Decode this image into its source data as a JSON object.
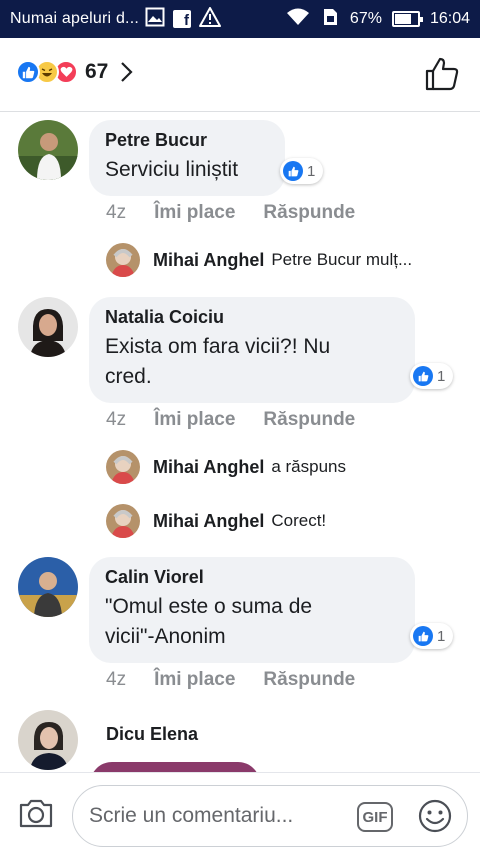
{
  "status_bar": {
    "carrier": "Numai apeluri d...",
    "battery": "67%",
    "time": "16:04",
    "icons": [
      "image-icon",
      "facebook-icon",
      "warning-icon",
      "wifi-icon",
      "sim-icon",
      "battery-icon"
    ]
  },
  "header": {
    "reaction_count": "67",
    "reaction_icons": [
      "like-icon",
      "haha-icon",
      "love-icon"
    ]
  },
  "comments": [
    {
      "author": "Petre Bucur",
      "text": "Serviciu liniștit",
      "reactions": "1",
      "time": "4z",
      "like": "Îmi place",
      "reply": "Răspunde",
      "replies": [
        {
          "name": "Mihai Anghel",
          "text": "Petre Bucur mulț..."
        }
      ]
    },
    {
      "author": "Natalia Coiciu",
      "text_line1": "Exista om fara vicii?! Nu",
      "text_line2": "cred.",
      "reactions": "1",
      "time": "4z",
      "like": "Îmi place",
      "reply": "Răspunde",
      "replies": [
        {
          "name": "Mihai Anghel",
          "text": "a răspuns"
        },
        {
          "name": "Mihai Anghel",
          "text": "Corect!"
        }
      ]
    },
    {
      "author": "Calin Viorel",
      "text_line1": "\"Omul este o suma de",
      "text_line2": "vicii\"-Anonim",
      "reactions": "1",
      "time": "4z",
      "like": "Îmi place",
      "reply": "Răspunde"
    },
    {
      "author": "Dicu Elena"
    }
  ],
  "composer": {
    "placeholder": "Scrie un comentariu...",
    "gif_label": "GIF"
  },
  "colors": {
    "status_bar": "#0d1b48",
    "like_blue": "#1877f2",
    "bubble": "#f0f2f5",
    "muted": "#8a8d91"
  }
}
